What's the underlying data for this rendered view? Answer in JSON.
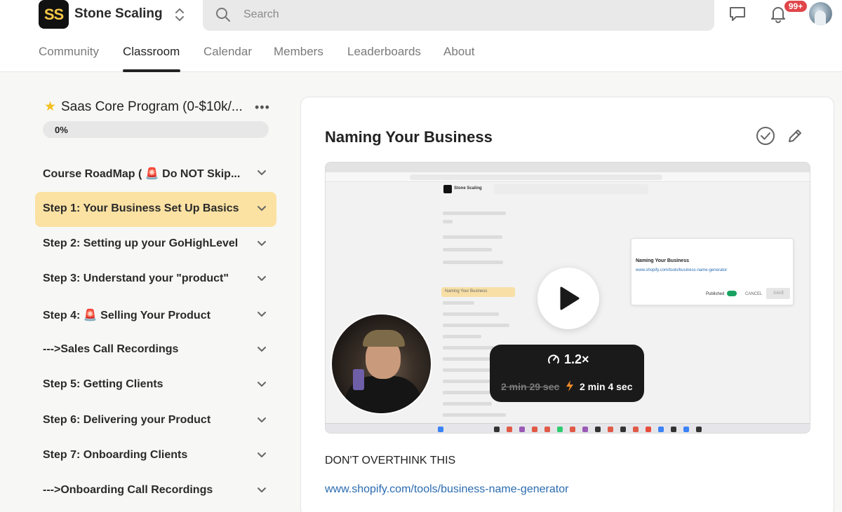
{
  "header": {
    "logo_text": "SS",
    "brand_name": "Stone Scaling",
    "search_placeholder": "Search",
    "notification_badge": "99+"
  },
  "nav": {
    "tabs": [
      {
        "label": "Community",
        "active": false
      },
      {
        "label": "Classroom",
        "active": true
      },
      {
        "label": "Calendar",
        "active": false
      },
      {
        "label": "Members",
        "active": false
      },
      {
        "label": "Leaderboards",
        "active": false
      },
      {
        "label": "About",
        "active": false
      }
    ]
  },
  "sidebar": {
    "course_title": "Saas Core Program (0-$10k/...",
    "progress_label": "0%",
    "progress_value": 0,
    "modules": [
      {
        "label": "Course RoadMap ( 🚨 Do NOT Skip...",
        "active": false
      },
      {
        "label": "Step 1: Your Business Set Up Basics",
        "active": true
      },
      {
        "label": "Step 2: Setting up your GoHighLevel",
        "active": false
      },
      {
        "label": "Step 3: Understand your \"product\"",
        "active": false
      },
      {
        "label": "Step 4:  🚨 Selling Your Product",
        "active": false
      },
      {
        "label": "--->Sales Call Recordings",
        "active": false
      },
      {
        "label": "Step 5: Getting Clients",
        "active": false
      },
      {
        "label": "Step 6: Delivering your Product",
        "active": false
      },
      {
        "label": "Step 7: Onboarding Clients",
        "active": false
      },
      {
        "label": "--->Onboarding Call Recordings",
        "active": false
      }
    ]
  },
  "lesson": {
    "title": "Naming Your Business",
    "video": {
      "playback_rate": "1.2×",
      "original_duration": "2 min 29 sec",
      "new_duration": "2 min 4 sec",
      "screen": {
        "brand": "Stone Scaling",
        "editor_title": "Naming Your Business",
        "editor_link": "www.shopify.com/tools/business-name-generator",
        "active_item": "Naming Your Business",
        "published_label": "Published",
        "cancel_label": "CANCEL",
        "save_label": "SAVE"
      }
    },
    "body_text": "DON'T OVERTHINK THIS",
    "link_text": "www.shopify.com/tools/business-name-generator"
  },
  "colors": {
    "accent_active": "#fbe2a3",
    "badge": "#e0454a",
    "link": "#2b6cb0"
  }
}
